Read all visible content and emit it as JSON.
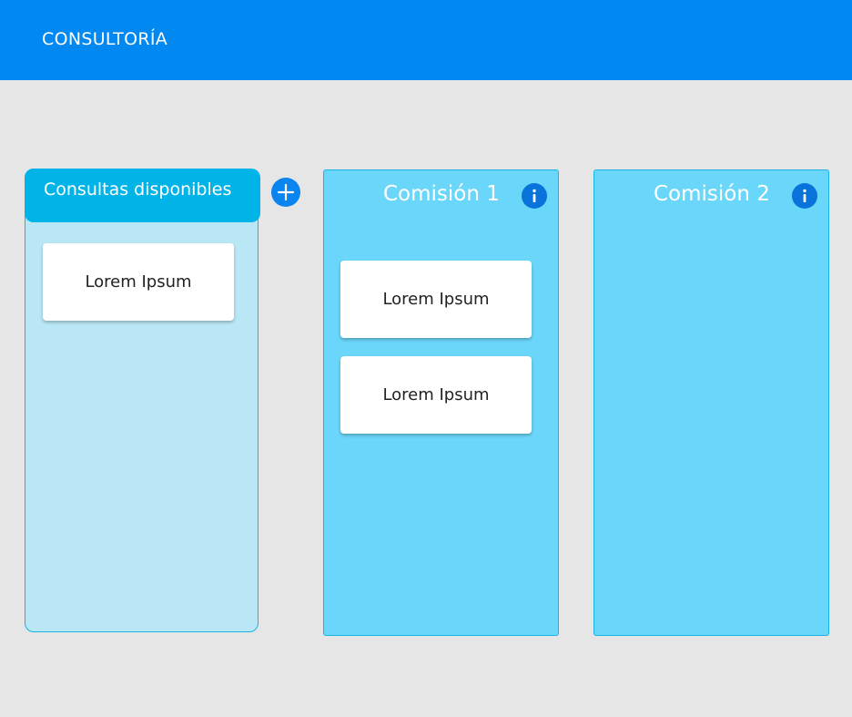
{
  "header": {
    "title": "CONSULTORÍA",
    "color": "#0288f1"
  },
  "available_column": {
    "title": "Consultas disponibles",
    "cards": [
      "Lorem Ipsum"
    ]
  },
  "add_button": {
    "icon": "plus-icon"
  },
  "commissions": [
    {
      "title": "Comisión 1",
      "info_icon": "info-icon",
      "cards": [
        "Lorem Ipsum",
        "Lorem Ipsum"
      ]
    },
    {
      "title": "Comisión 2",
      "info_icon": "info-icon",
      "cards": []
    }
  ],
  "colors": {
    "background": "#e6e6e6",
    "available_column_bg": "#b9e7f6",
    "available_header_bg": "#00b4e8",
    "commission_bg": "#6ad6f9",
    "button_blue": "#0a84ef"
  }
}
